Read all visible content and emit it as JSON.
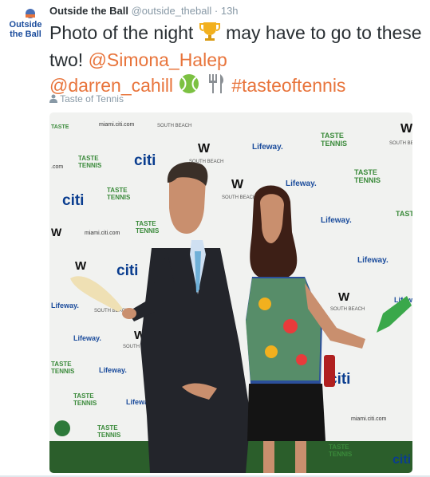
{
  "tweet": {
    "author_name": "Outside the Ball",
    "author_handle": "@outside_theball",
    "separator": "·",
    "time": "13h",
    "text_part1": "Photo of the night",
    "text_part2": "may have to go to these two!",
    "mention1": "@Simona_Halep",
    "mention2": "@darren_cahill",
    "hashtag": "#tasteoftennis",
    "location": "Taste of Tennis",
    "avatar_line1": "Outside",
    "avatar_line2": "the Ball"
  },
  "backdrop": {
    "w_brand": "W",
    "w_sub": "SOUTH BEACH",
    "citi": "citi",
    "lifeway": "Lifeway.",
    "taste_line1": "TASTE",
    "taste_line2": "TENNIS",
    "site": "miami.citi.com",
    "com": ".com"
  },
  "colors": {
    "accent": "#e8743b",
    "name": "#292f33",
    "muted": "#8899a6",
    "citi_blue": "#0a3d8f",
    "lifeway_blue": "#1b4c9c",
    "taste_green": "#3a8a3a"
  },
  "icons": {
    "trophy": "trophy-icon",
    "tennis_ball": "tennis-ball-icon",
    "fork_knife": "fork-and-knife-icon",
    "location": "person-location-icon"
  }
}
